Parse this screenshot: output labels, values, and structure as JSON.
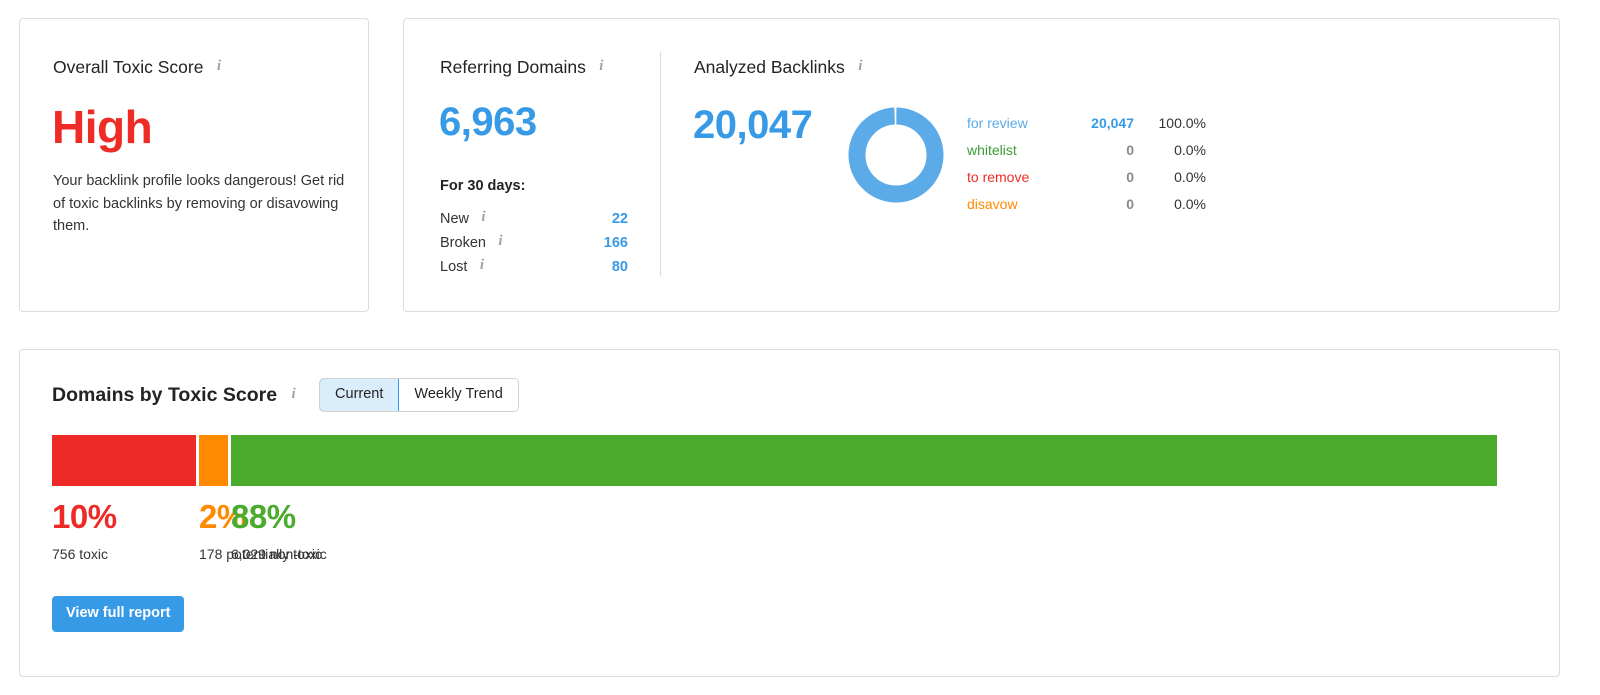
{
  "toxic_score_card": {
    "title": "Overall Toxic Score",
    "info_icon": "info-icon",
    "verdict": "High",
    "verdict_color": "#ef2b26",
    "description": "Your backlink profile looks dangerous! Get rid of toxic backlinks by removing or disavowing them."
  },
  "referring_domains": {
    "title": "Referring Domains",
    "info_icon": "info-icon",
    "value": "6,963",
    "period_label": "For 30 days:",
    "stats": [
      {
        "label": "New",
        "value": "22",
        "info_icon": "info-icon"
      },
      {
        "label": "Broken",
        "value": "166",
        "info_icon": "info-icon"
      },
      {
        "label": "Lost",
        "value": "80",
        "info_icon": "info-icon"
      }
    ]
  },
  "analyzed_backlinks": {
    "title": "Analyzed Backlinks",
    "info_icon": "info-icon",
    "value": "20,047",
    "donut": {
      "segments": [
        {
          "name": "for review",
          "percent": 100.0,
          "color": "#5aabe8"
        }
      ]
    },
    "legend": [
      {
        "name": "for review",
        "count": "20,047",
        "percent": "100.0%",
        "color": "#5aabe8",
        "active": true
      },
      {
        "name": "whitelist",
        "count": "0",
        "percent": "0.0%",
        "color": "#3f9c35",
        "active": false
      },
      {
        "name": "to remove",
        "count": "0",
        "percent": "0.0%",
        "color": "#ef2b26",
        "active": false
      },
      {
        "name": "disavow",
        "count": "0",
        "percent": "0.0%",
        "color": "#ff8a00",
        "active": false
      }
    ]
  },
  "domains_by_toxic_score": {
    "title": "Domains by Toxic Score",
    "info_icon": "info-icon",
    "tabs": [
      {
        "label": "Current",
        "active": true
      },
      {
        "label": "Weekly Trend",
        "active": false
      }
    ],
    "view_report_label": "View full report"
  },
  "chart_data": {
    "type": "bar",
    "title": "Domains by Toxic Score",
    "orientation": "horizontal-stacked",
    "total_domains": 6963,
    "categories": [
      "toxic",
      "potentially toxic",
      "non-toxic"
    ],
    "values": [
      10,
      2,
      88
    ],
    "counts": [
      "756",
      "178",
      "6,029"
    ],
    "percent_labels": [
      "10%",
      "2%",
      "88%"
    ],
    "sublabels": [
      "756 toxic",
      "178 potentially toxic",
      "6,029 non-toxic"
    ],
    "colors": [
      "#ee2a28",
      "#ff8a00",
      "#4bab2d"
    ],
    "xlabel": "",
    "ylabel": "",
    "ylim": [
      0,
      100
    ],
    "grid": false,
    "legend": "below-bar"
  }
}
